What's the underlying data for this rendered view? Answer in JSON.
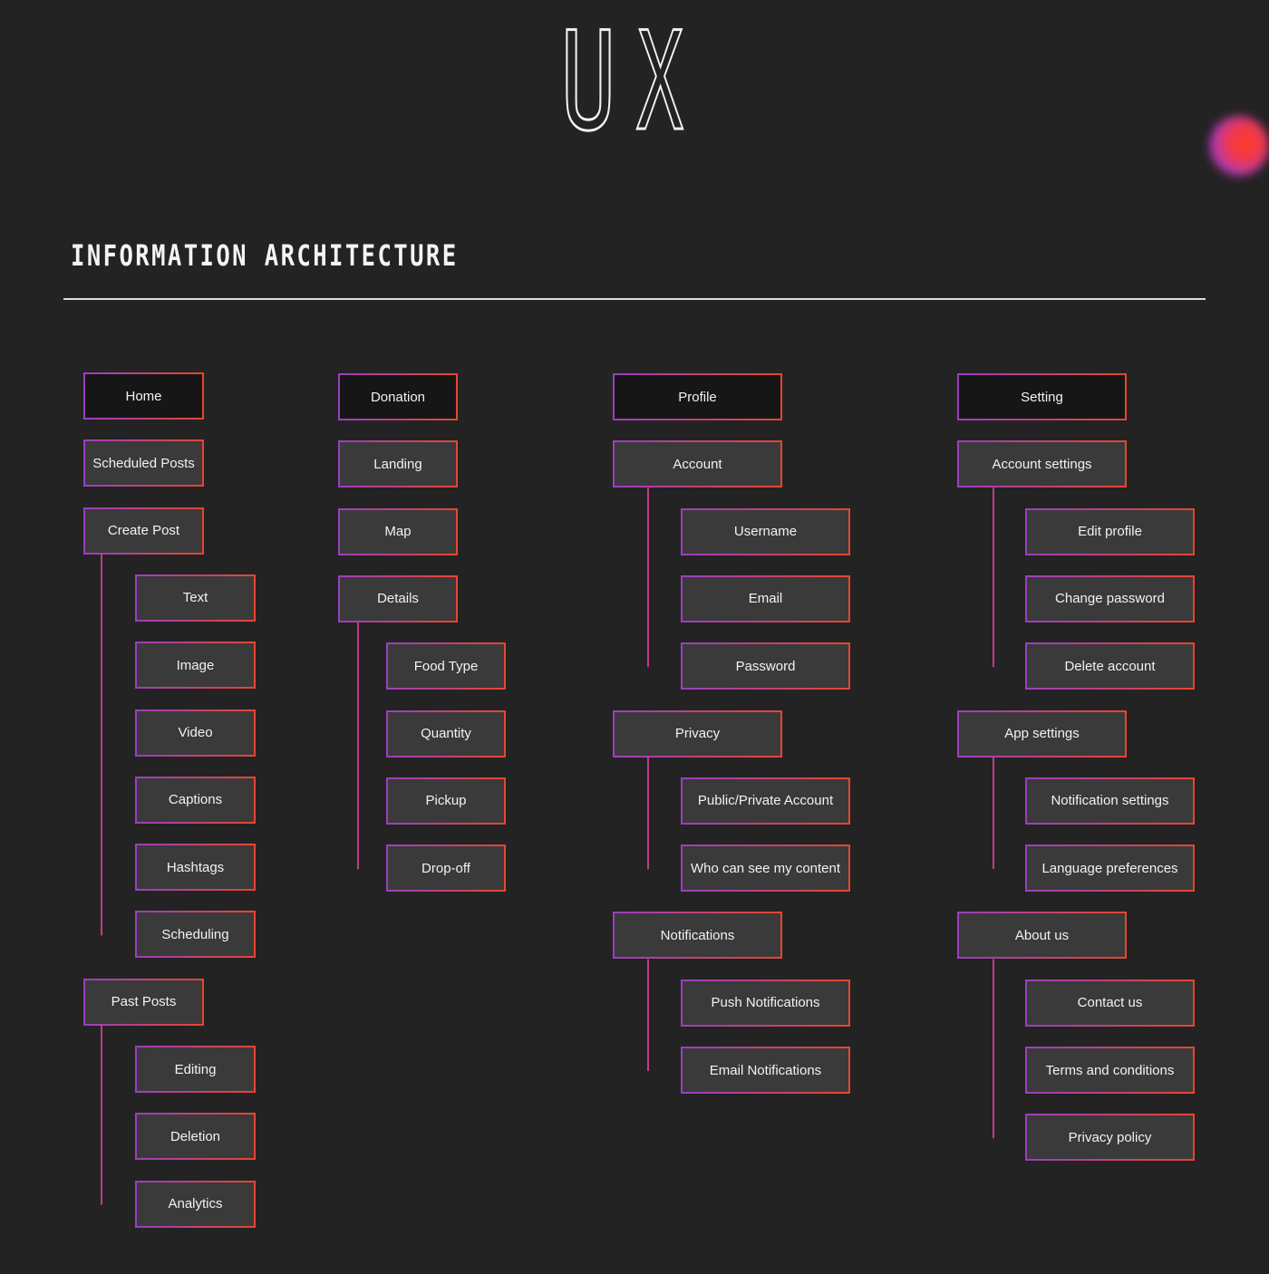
{
  "logo": {
    "letter_1": "U",
    "letter_2": "X"
  },
  "section_title": "INFORMATION ARCHITECTURE",
  "colors": {
    "background": "#232323",
    "node_fill": "#3a3a3a",
    "root_fill": "#161616",
    "gradient_start": "#9a3fc2",
    "gradient_end": "#e8452f",
    "line": "#c43a8a"
  },
  "columns": [
    {
      "id": "home",
      "items": [
        {
          "label": "Home",
          "root": true
        },
        {
          "label": "Scheduled Posts"
        },
        {
          "label": "Create Post",
          "children": [
            "Text",
            "Image",
            "Video",
            "Captions",
            "Hashtags",
            "Scheduling"
          ]
        },
        {
          "label": "Past Posts",
          "children": [
            "Editing",
            "Deletion",
            "Analytics"
          ]
        }
      ]
    },
    {
      "id": "donation",
      "items": [
        {
          "label": "Donation",
          "root": true
        },
        {
          "label": "Landing"
        },
        {
          "label": "Map"
        },
        {
          "label": "Details",
          "children": [
            "Food Type",
            "Quantity",
            "Pickup",
            "Drop-off"
          ]
        }
      ]
    },
    {
      "id": "profile",
      "items": [
        {
          "label": "Profile",
          "root": true
        },
        {
          "label": "Account",
          "children": [
            "Username",
            "Email",
            "Password"
          ]
        },
        {
          "label": "Privacy",
          "children": [
            "Public/Private Account",
            "Who can see my content"
          ]
        },
        {
          "label": "Notifications",
          "children": [
            "Push Notifications",
            "Email Notifications"
          ]
        }
      ]
    },
    {
      "id": "setting",
      "items": [
        {
          "label": "Setting",
          "root": true
        },
        {
          "label": "Account settings",
          "children": [
            "Edit profile",
            "Change password",
            "Delete account"
          ]
        },
        {
          "label": "App settings",
          "children": [
            "Notification settings",
            "Language preferences"
          ]
        },
        {
          "label": "About us",
          "children": [
            "Contact us",
            "Terms and conditions",
            "Privacy policy"
          ]
        }
      ]
    }
  ]
}
